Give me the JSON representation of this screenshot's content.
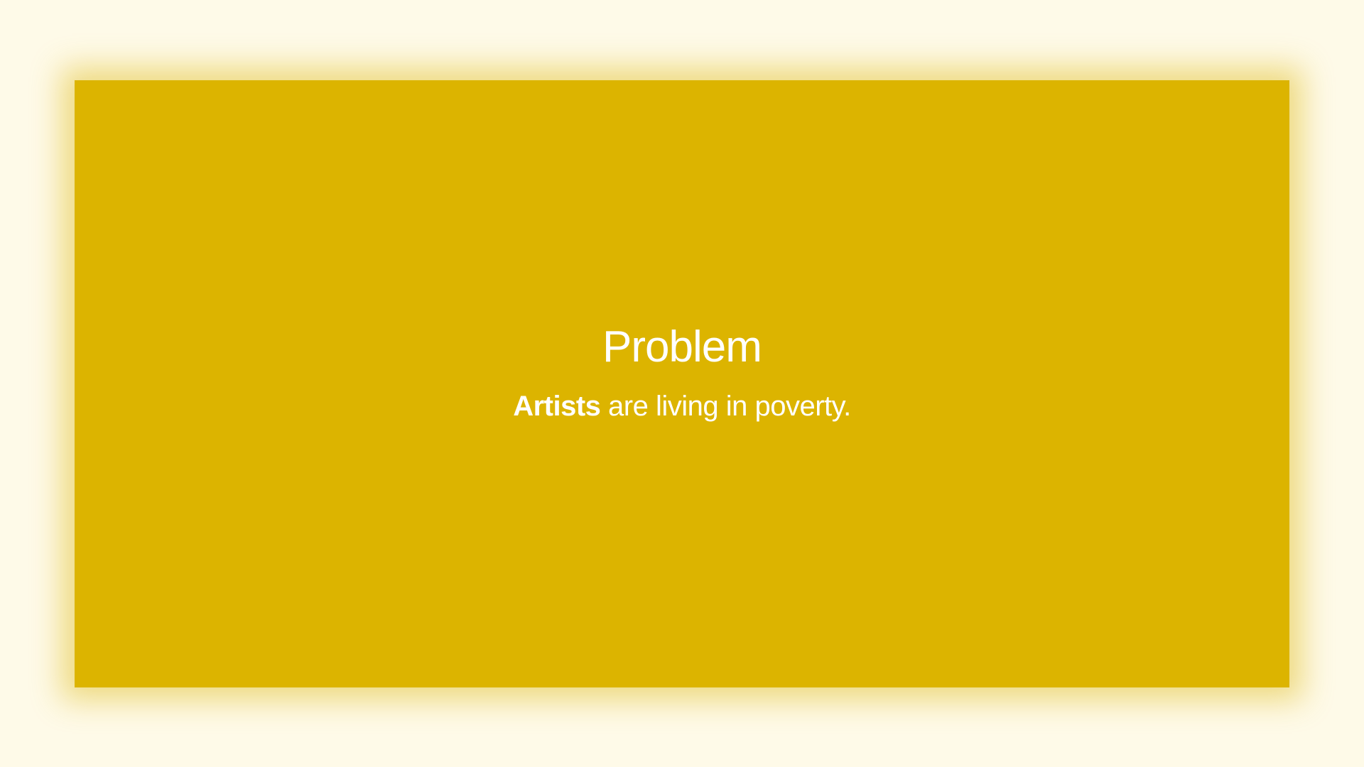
{
  "slide": {
    "title": "Problem",
    "subtitle_bold": "Artists",
    "subtitle_rest": " are living in poverty."
  },
  "colors": {
    "page_background": "#fefae8",
    "slide_background": "#dcb400",
    "text": "#ffffff"
  }
}
